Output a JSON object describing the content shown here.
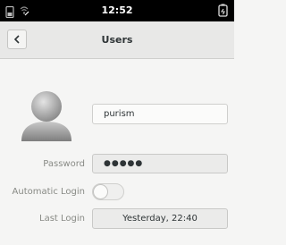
{
  "status_bar": {
    "time": "12:52",
    "icons": [
      "phone-icon",
      "wifi-icon",
      "battery-icon"
    ]
  },
  "header": {
    "title": "Users",
    "back_icon": "chevron-left-icon"
  },
  "user": {
    "username": "purism",
    "avatar_icon": "user-avatar-icon"
  },
  "fields": {
    "password": {
      "label": "Password",
      "value": "●●●●●"
    },
    "automatic_login": {
      "label": "Automatic Login",
      "enabled": false
    },
    "last_login": {
      "label": "Last Login",
      "value": "Yesterday, 22:40"
    }
  }
}
